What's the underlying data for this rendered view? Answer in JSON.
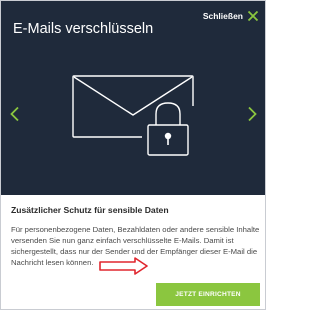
{
  "dialog": {
    "title": "E-Mails verschlüsseln",
    "close_label": "Schließen"
  },
  "icons": {
    "close": "close-icon",
    "prev": "chevron-left-icon",
    "next": "chevron-right-icon",
    "illustration": "envelope-lock-icon",
    "pointer": "arrow-right-icon"
  },
  "colors": {
    "hero_background": "#1f2a3b",
    "accent": "#8bc63f",
    "arrow": "#e0262e"
  },
  "content": {
    "heading": "Zusätzlicher Schutz für sensible Daten",
    "body": "Für personenbezogene Daten, Bezahldaten oder andere sensible Inhalte versenden Sie nun ganz einfach verschlüsselte E-Mails. Damit ist sichergestellt, dass nur der Sender und der Empfänger dieser E-Mail die Nachricht lesen können."
  },
  "cta": {
    "label": "JETZT EINRICHTEN"
  }
}
